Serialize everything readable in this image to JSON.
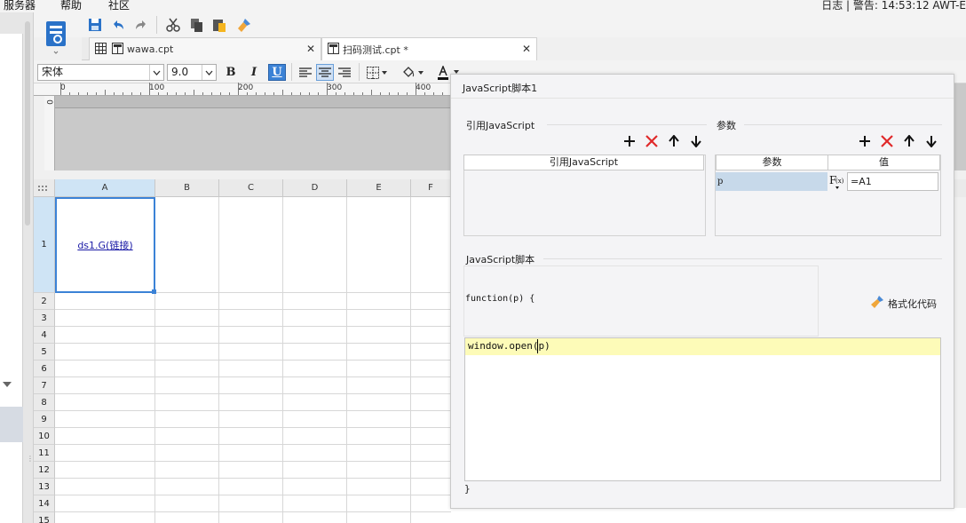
{
  "menubar": {
    "items": [
      "服务器",
      "帮助",
      "社区"
    ],
    "status": "日志 | 警告: 14:53:12 AWT-E"
  },
  "tabs": [
    {
      "label": "wawa.cpt"
    },
    {
      "label": "扫码测试.cpt *"
    }
  ],
  "format_toolbar": {
    "font": "宋体",
    "size": "9.0",
    "bold": "B",
    "italic": "I",
    "underline": "U"
  },
  "ruler": {
    "zero": "0",
    "marks": [
      "0",
      "100",
      "200",
      "300",
      "400"
    ]
  },
  "grid": {
    "columns": [
      "A",
      "B",
      "C",
      "D",
      "E",
      "F"
    ],
    "rows": [
      "1",
      "2",
      "3",
      "4",
      "5",
      "6",
      "7",
      "8",
      "9",
      "10",
      "11",
      "12",
      "13",
      "14",
      "15"
    ],
    "a1": "ds1.G(链接)"
  },
  "dialog": {
    "title": "JavaScript脚本1",
    "ref_section": "引用JavaScript",
    "ref_table_header": "引用JavaScript",
    "param_section": "参数",
    "param_headers": [
      "参数",
      "值"
    ],
    "param_row": {
      "name": "p",
      "value": "=A1"
    },
    "script_section": "JavaScript脚本",
    "function_signature": "function(p) {",
    "format_button": "格式化代码",
    "code": "window.open(p)",
    "closing": "}"
  }
}
